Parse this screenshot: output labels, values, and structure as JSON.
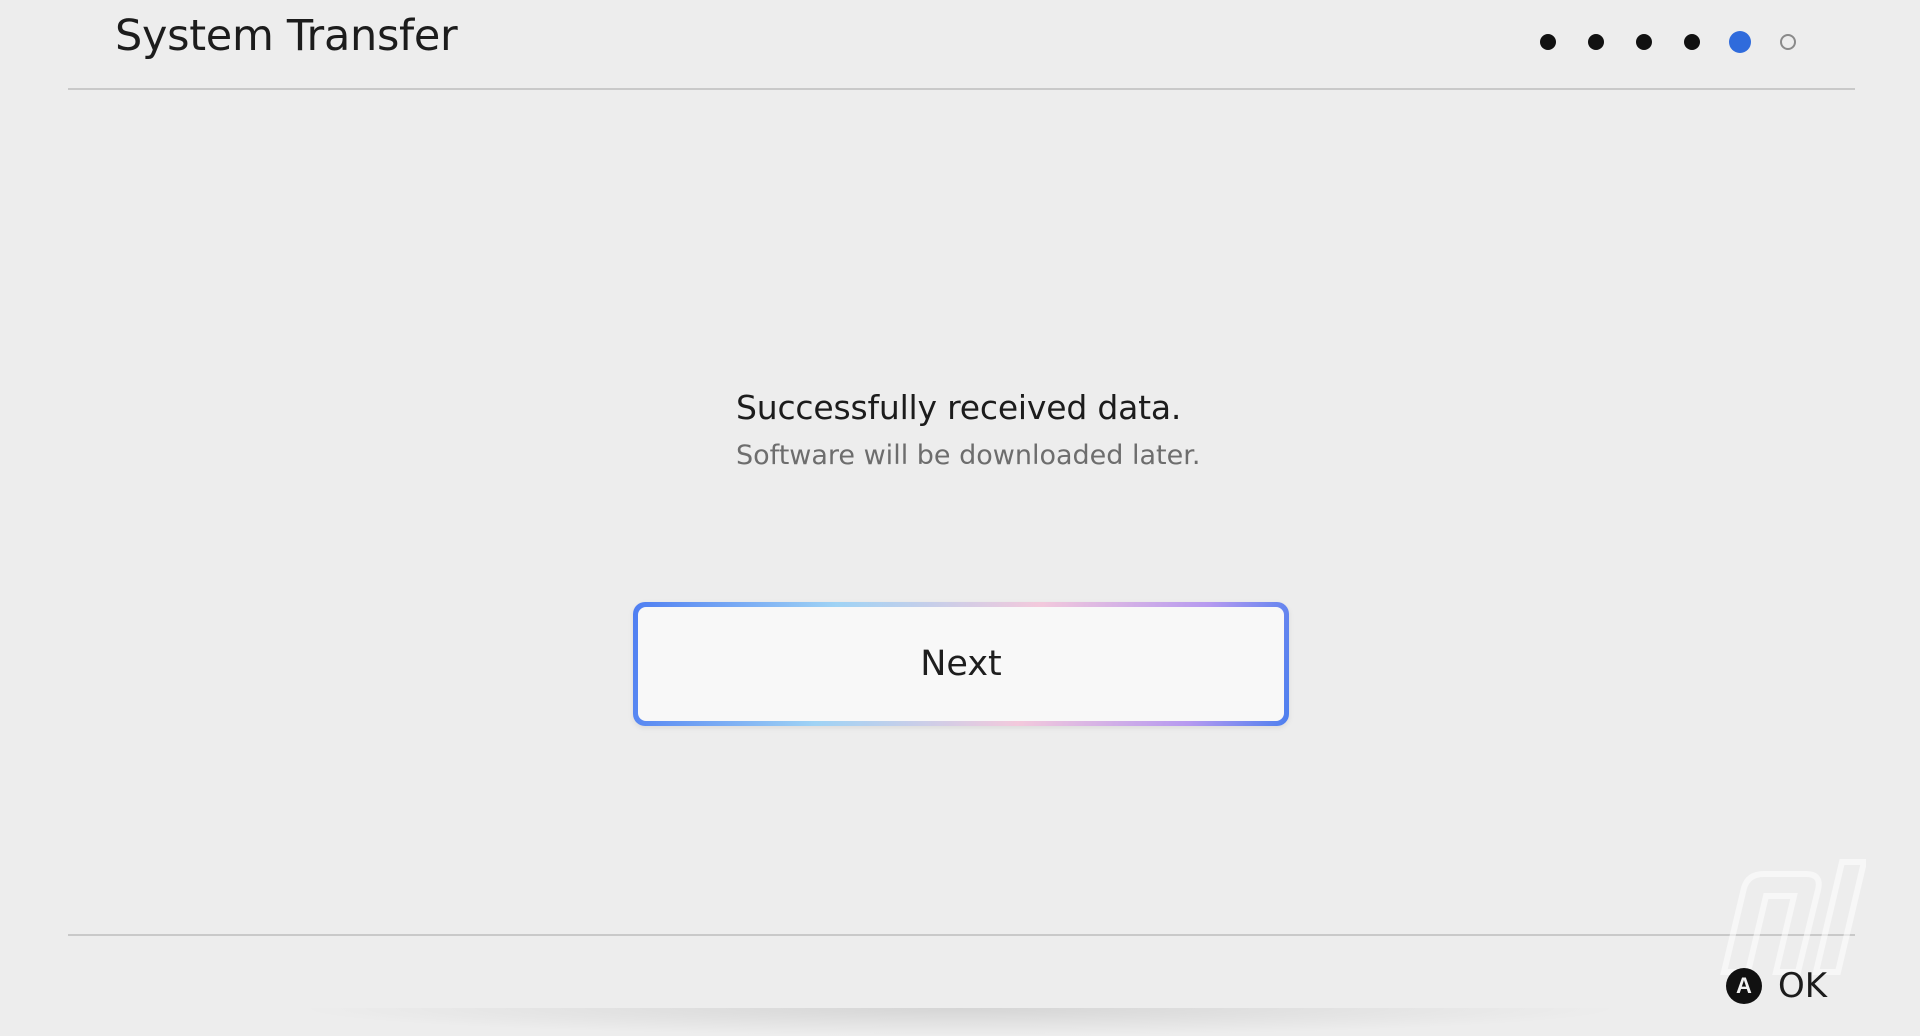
{
  "header": {
    "title": "System Transfer",
    "progress": {
      "total_steps": 6,
      "current_step": 5,
      "steps": [
        "complete",
        "complete",
        "complete",
        "complete",
        "current",
        "pending"
      ],
      "current_color": "#2f6bdc"
    }
  },
  "message": {
    "title": "Successfully received data.",
    "subtitle": "Software will be downloaded later."
  },
  "next_button": {
    "label": "Next"
  },
  "footer": {
    "button_glyph": "A",
    "ok_label": "OK"
  },
  "watermark": {
    "text": "nl",
    "icon": "nl-watermark-logo"
  }
}
